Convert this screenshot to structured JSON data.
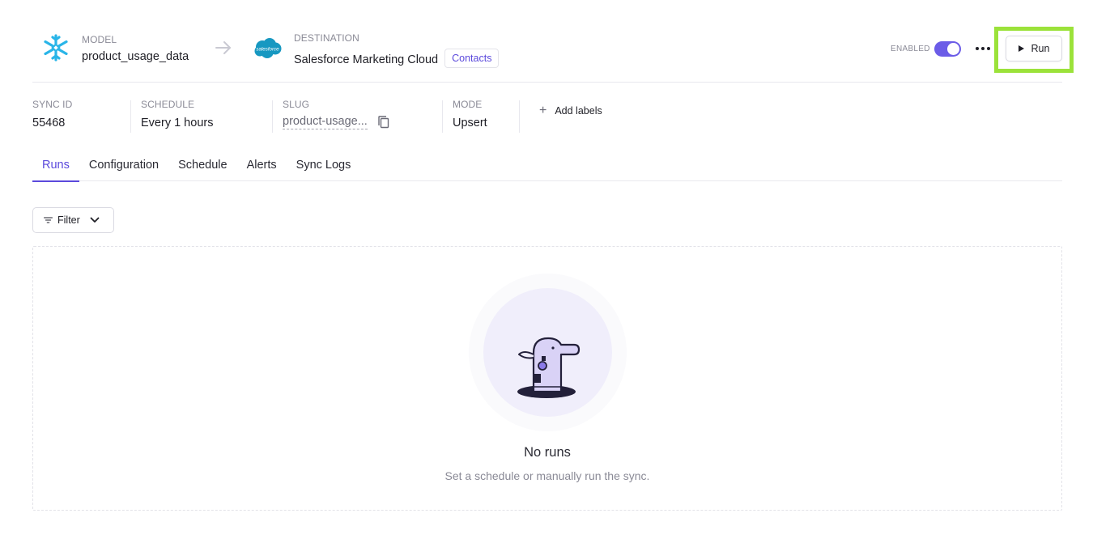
{
  "model": {
    "label": "MODEL",
    "name": "product_usage_data",
    "icon": "snowflake-icon"
  },
  "destination": {
    "label": "DESTINATION",
    "name": "Salesforce Marketing Cloud",
    "object": "Contacts",
    "icon": "salesforce-icon",
    "logo_text": "salesforce"
  },
  "status": {
    "enabled_label": "ENABLED",
    "enabled": true
  },
  "actions": {
    "run_label": "Run"
  },
  "meta": {
    "sync_id": {
      "label": "SYNC ID",
      "value": "55468"
    },
    "schedule": {
      "label": "SCHEDULE",
      "value": "Every 1 hours"
    },
    "slug": {
      "label": "SLUG",
      "value": "product-usage..."
    },
    "mode": {
      "label": "MODE",
      "value": "Upsert"
    },
    "add_labels": "Add labels"
  },
  "tabs": [
    {
      "label": "Runs",
      "active": true
    },
    {
      "label": "Configuration",
      "active": false
    },
    {
      "label": "Schedule",
      "active": false
    },
    {
      "label": "Alerts",
      "active": false
    },
    {
      "label": "Sync Logs",
      "active": false
    }
  ],
  "filter": {
    "label": "Filter"
  },
  "empty_state": {
    "title": "No runs",
    "subtitle": "Set a schedule or manually run the sync."
  },
  "colors": {
    "accent": "#5b49dc",
    "toggle": "#6b5ce7",
    "highlight": "#9be23a",
    "snowflake": "#29b5e8",
    "salesforce": "#1798c1"
  }
}
